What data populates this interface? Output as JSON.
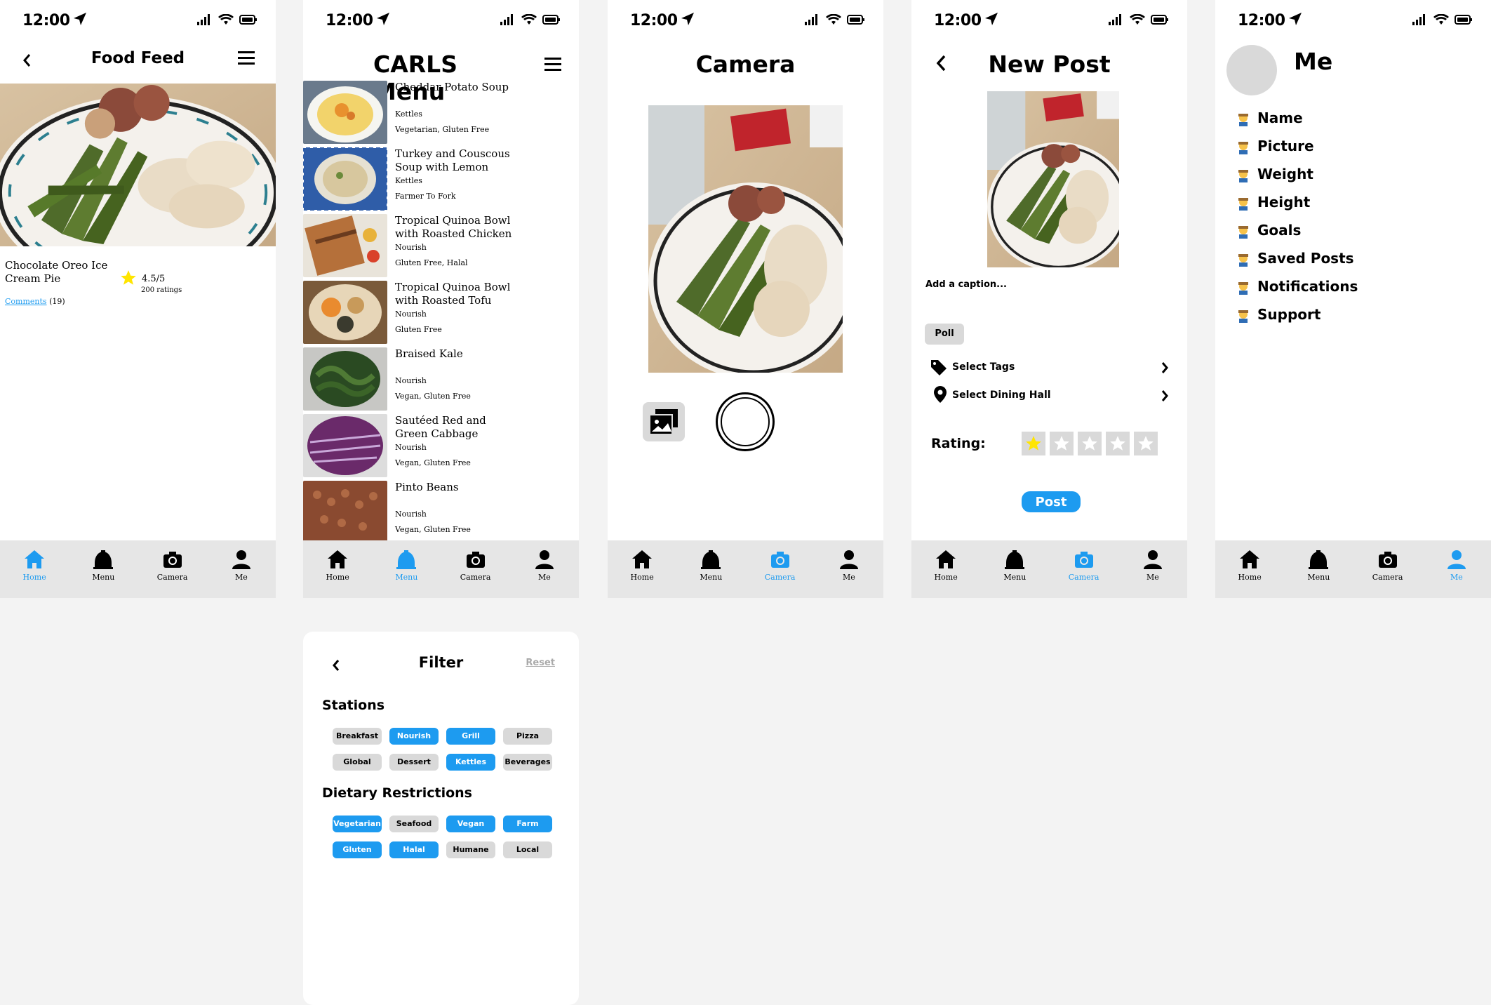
{
  "status": {
    "time": "12:00"
  },
  "tabs": [
    "Home",
    "Menu",
    "Camera",
    "Me"
  ],
  "colors": {
    "accent": "#1d9bf0",
    "chip": "#d9d9d9",
    "tabbar": "#e6e6e6",
    "star": "#ffe500"
  },
  "food_feed": {
    "title": "Food Feed",
    "post_title": "Chocolate Oreo Ice Cream Pie",
    "rating": "4.5/5",
    "rating_count": "200 ratings",
    "comments_label": "Comments",
    "comments_count": "(19)"
  },
  "menu": {
    "title": "CARLS Menu",
    "items": [
      {
        "name": "Cheddar Potato Soup",
        "station": "Kettles",
        "diet": "Vegetarian, Gluten Free"
      },
      {
        "name": "Turkey and Couscous Soup with Lemon",
        "station": "Kettles",
        "diet": "Farmer To Fork"
      },
      {
        "name": "Tropical Quinoa Bowl with Roasted Chicken",
        "station": "Nourish",
        "diet": "Gluten Free, Halal"
      },
      {
        "name": "Tropical Quinoa Bowl with Roasted Tofu",
        "station": "Nourish",
        "diet": "Gluten Free"
      },
      {
        "name": "Braised Kale",
        "station": "Nourish",
        "diet": "Vegan, Gluten Free"
      },
      {
        "name": "Sautéed Red and Green Cabbage",
        "station": "Nourish",
        "diet": "Vegan, Gluten Free"
      },
      {
        "name": "Pinto Beans",
        "station": "Nourish",
        "diet": "Vegan, Gluten Free"
      }
    ]
  },
  "camera": {
    "title": "Camera"
  },
  "new_post": {
    "title": "New Post",
    "caption_placeholder": "Add a caption...",
    "poll": "Poll",
    "select_tags": "Select Tags",
    "select_dining_hall": "Select Dining Hall",
    "rating_label": "Rating:",
    "rating_value": 1,
    "rating_max": 5,
    "post_button": "Post"
  },
  "me": {
    "title": "Me",
    "items": [
      "Name",
      "Picture",
      "Weight",
      "Height",
      "Goals",
      "Saved Posts",
      "Notifications",
      "Support"
    ]
  },
  "filter": {
    "title": "Filter",
    "reset": "Reset",
    "stations_title": "Stations",
    "stations": [
      {
        "label": "Breakfast",
        "on": false
      },
      {
        "label": "Nourish",
        "on": true
      },
      {
        "label": "Grill",
        "on": true
      },
      {
        "label": "Pizza",
        "on": false
      },
      {
        "label": "Global",
        "on": false
      },
      {
        "label": "Dessert",
        "on": false
      },
      {
        "label": "Kettles",
        "on": true
      },
      {
        "label": "Beverages",
        "on": false
      }
    ],
    "dietary_title": "Dietary Restrictions",
    "dietary": [
      {
        "label": "Vegetarian",
        "on": true
      },
      {
        "label": "Seafood",
        "on": false
      },
      {
        "label": "Vegan",
        "on": true
      },
      {
        "label": "Farm",
        "on": true
      },
      {
        "label": "Gluten",
        "on": true
      },
      {
        "label": "Halal",
        "on": true
      },
      {
        "label": "Humane",
        "on": false
      },
      {
        "label": "Local",
        "on": false
      }
    ]
  }
}
